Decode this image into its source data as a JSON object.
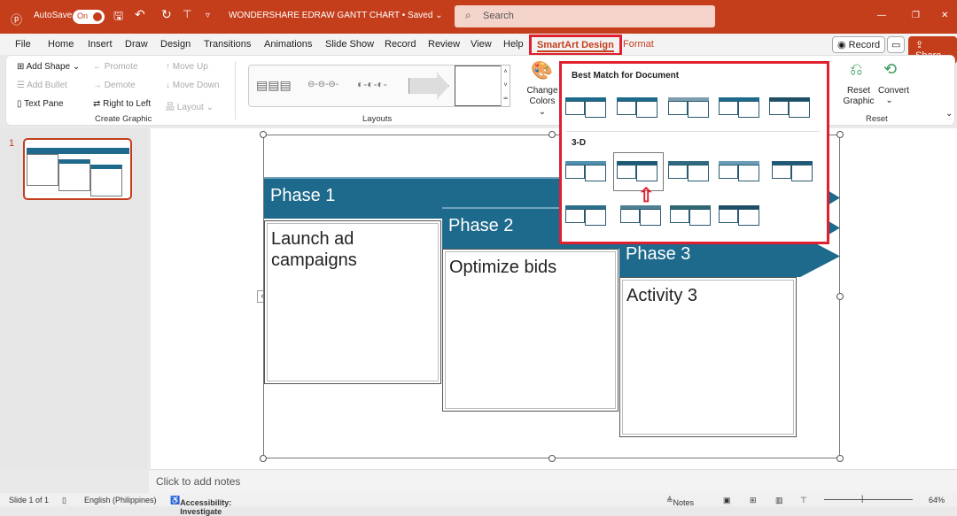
{
  "titlebar": {
    "autosave": "AutoSave",
    "toggle": "On",
    "title": "WONDERSHARE EDRAW GANTT CHART • Saved ⌄",
    "search_placeholder": "Search",
    "min": "—",
    "restore": "❐",
    "close": "✕"
  },
  "tabs": [
    "File",
    "Home",
    "Insert",
    "Draw",
    "Design",
    "Transitions",
    "Animations",
    "Slide Show",
    "Record",
    "Review",
    "View",
    "Help",
    "SmartArt Design",
    "Format"
  ],
  "tab_actions": {
    "record": "Record",
    "share": "Share"
  },
  "ribbon": {
    "create_graphic": {
      "add_shape": "Add Shape",
      "add_bullet": "Add Bullet",
      "text_pane": "Text Pane",
      "promote": "Promote",
      "demote": "Demote",
      "right_to_left": "Right to Left",
      "move_up": "Move Up",
      "move_down": "Move Down",
      "layout": "Layout",
      "group": "Create Graphic"
    },
    "layouts": {
      "group": "Layouts"
    },
    "change_colors": "Change Colors ⌄",
    "reset": {
      "reset_graphic": "Reset Graphic",
      "convert": "Convert",
      "group": "Reset"
    }
  },
  "styles_dropdown": {
    "section1": "Best Match for Document",
    "section2": "3-D"
  },
  "slide": {
    "phases": [
      {
        "title": "Phase 1",
        "activity": "Launch ad campaigns"
      },
      {
        "title": "Phase 2",
        "activity": "Optimize bids"
      },
      {
        "title": "Phase 3",
        "activity": "Activity 3"
      }
    ]
  },
  "thumbnail_number": "1",
  "notes_placeholder": "Click to add notes",
  "status": {
    "slide": "Slide 1 of 1",
    "language": "English (Philippines)",
    "accessibility": "Accessibility: Investigate",
    "notes": "Notes",
    "zoom": "64%"
  },
  "colors": {
    "accent": "#c43e1c",
    "smartart": "#1e6a8c",
    "highlight": "#e0202e"
  }
}
